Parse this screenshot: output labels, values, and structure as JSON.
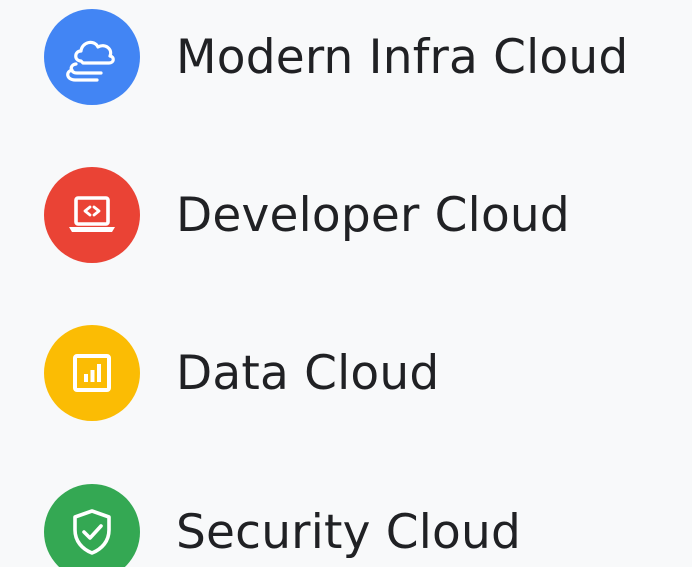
{
  "items": [
    {
      "label": "Modern Infra Cloud",
      "icon": "cloud-layers-icon",
      "color": "#4285f4"
    },
    {
      "label": "Developer Cloud",
      "icon": "laptop-code-icon",
      "color": "#ea4335"
    },
    {
      "label": "Data Cloud",
      "icon": "bar-chart-icon",
      "color": "#fbbc04"
    },
    {
      "label": "Security Cloud",
      "icon": "shield-check-icon",
      "color": "#34a853"
    }
  ]
}
